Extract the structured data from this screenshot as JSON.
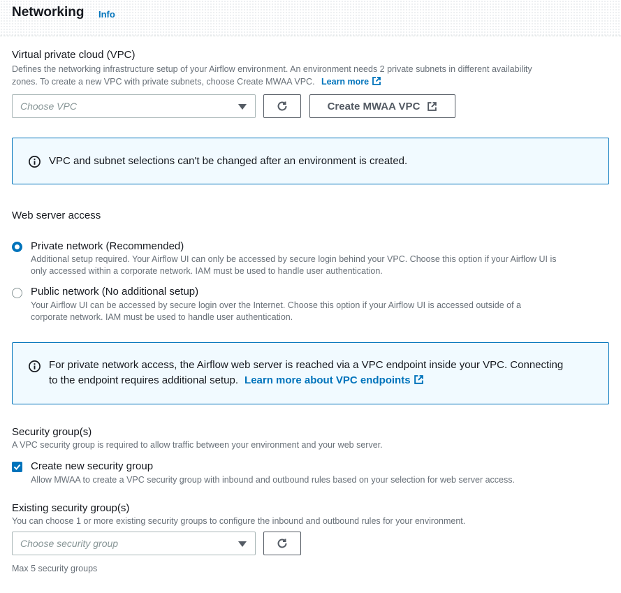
{
  "header": {
    "title": "Networking",
    "info_link": "Info"
  },
  "vpc": {
    "label": "Virtual private cloud (VPC)",
    "description_1": "Defines the networking infrastructure setup of your Airflow environment. An environment needs 2 private subnets in different availability",
    "description_2": "zones. To create a new VPC with private subnets, choose Create MWAA VPC.",
    "learn_more": "Learn more",
    "select_placeholder": "Choose VPC",
    "create_button": "Create MWAA VPC",
    "alert_text": "VPC and subnet selections can't be changed after an environment is created."
  },
  "web_server_access": {
    "label": "Web server access",
    "options": [
      {
        "label": "Private network (Recommended)",
        "desc_1": "Additional setup required. Your Airflow UI can only be accessed by secure login behind your VPC. Choose this option if your Airflow UI is",
        "desc_2": "only accessed within a corporate network. IAM must be used to handle user authentication.",
        "selected": true
      },
      {
        "label": "Public network (No additional setup)",
        "desc_1": "Your Airflow UI can be accessed by secure login over the Internet. Choose this option if your Airflow UI is accessed outside of a",
        "desc_2": "corporate network. IAM must be used to handle user authentication.",
        "selected": false
      }
    ],
    "alert_line_1": "For private network access, the Airflow web server is reached via a VPC endpoint inside your VPC. Connecting",
    "alert_line_2": "to the endpoint requires additional setup.",
    "alert_link": "Learn more about VPC endpoints"
  },
  "security_groups": {
    "label": "Security group(s)",
    "description": "A VPC security group is required to allow traffic between your environment and your web server.",
    "create_checkbox_label": "Create new security group",
    "create_checkbox_desc": "Allow MWAA to create a VPC security group with inbound and outbound rules based on your selection for web server access.",
    "create_checked": true
  },
  "existing_security_groups": {
    "label": "Existing security group(s)",
    "description": "You can choose 1 or more existing security groups to configure the inbound and outbound rules for your environment.",
    "select_placeholder": "Choose security group",
    "hint": "Max 5 security groups"
  },
  "colors": {
    "accent": "#0073bb",
    "alert_bg": "#f1faff",
    "text": "#16191f",
    "muted": "#687078"
  },
  "icons": [
    "refresh-icon",
    "external-link-icon",
    "info-circle-icon",
    "caret-down-icon",
    "checkmark-icon"
  ]
}
